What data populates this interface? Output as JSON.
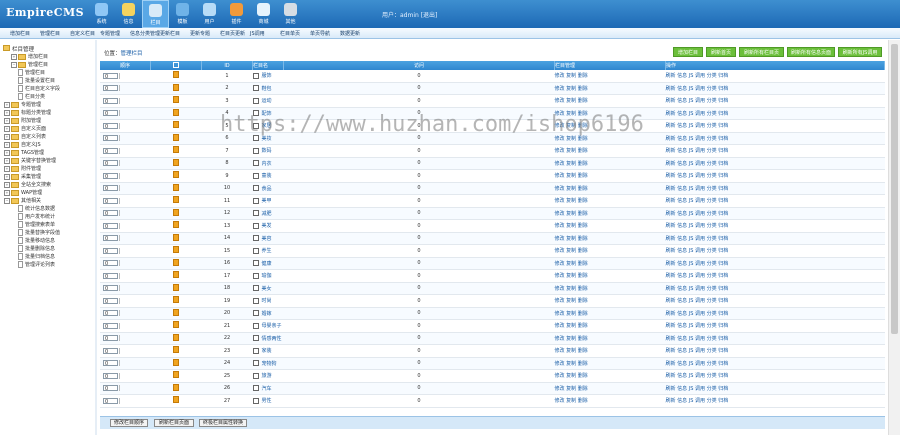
{
  "app": {
    "logo": "EmpireCMS",
    "user_info": "用户：admin  [退出]"
  },
  "topnav": [
    {
      "label": "系统",
      "icon": "system-icon",
      "color": "#8fc7f5"
    },
    {
      "label": "信息",
      "icon": "edit-icon",
      "color": "#f4d35e"
    },
    {
      "label": "栏目",
      "icon": "folder-icon",
      "color": "#d8eaf8"
    },
    {
      "label": "模板",
      "icon": "template-icon",
      "color": "#6fb3e8"
    },
    {
      "label": "用户",
      "icon": "user-icon",
      "color": "#b8dcf7"
    },
    {
      "label": "插件",
      "icon": "plugin-icon",
      "color": "#f29a3a"
    },
    {
      "label": "商城",
      "icon": "shop-icon",
      "color": "#e6f3fc"
    },
    {
      "label": "其他",
      "icon": "gear-icon",
      "color": "#d6dde4"
    }
  ],
  "subnav": [
    "增加栏目",
    "管理栏目",
    "自定义栏目",
    "专题管理",
    "信息分类管理",
    "更新栏目",
    "更新专题",
    "栏目页更新",
    "JS调用",
    "栏目单页",
    "单页导航",
    "数据更新"
  ],
  "sidebar": {
    "title": "栏目管理",
    "items": [
      {
        "label": "增加栏目",
        "indent": 1,
        "kind": "folder"
      },
      {
        "label": "管理栏目",
        "indent": 1,
        "kind": "folder",
        "open": true
      },
      {
        "label": "管理栏目",
        "indent": 2,
        "kind": "doc"
      },
      {
        "label": "批量设置栏目",
        "indent": 2,
        "kind": "doc"
      },
      {
        "label": "栏目自定义字段",
        "indent": 2,
        "kind": "doc"
      },
      {
        "label": "栏目分类",
        "indent": 2,
        "kind": "doc"
      },
      {
        "label": "专题管理",
        "indent": 0,
        "kind": "folder"
      },
      {
        "label": "标题分类管理",
        "indent": 0,
        "kind": "folder"
      },
      {
        "label": "附加管理",
        "indent": 0,
        "kind": "folder"
      },
      {
        "label": "自定义页面",
        "indent": 0,
        "kind": "folder"
      },
      {
        "label": "自定义列表",
        "indent": 0,
        "kind": "folder"
      },
      {
        "label": "自定义JS",
        "indent": 0,
        "kind": "folder"
      },
      {
        "label": "TAGS管理",
        "indent": 0,
        "kind": "folder"
      },
      {
        "label": "关键字替换管理",
        "indent": 0,
        "kind": "folder"
      },
      {
        "label": "附件管理",
        "indent": 0,
        "kind": "folder"
      },
      {
        "label": "采集管理",
        "indent": 0,
        "kind": "folder"
      },
      {
        "label": "全站全文搜索",
        "indent": 0,
        "kind": "folder"
      },
      {
        "label": "WAP管理",
        "indent": 0,
        "kind": "folder"
      },
      {
        "label": "其他相关",
        "indent": 0,
        "kind": "folder",
        "open": true
      },
      {
        "label": "统计信息数据",
        "indent": 2,
        "kind": "doc"
      },
      {
        "label": "用户发布统计",
        "indent": 2,
        "kind": "doc"
      },
      {
        "label": "管理搜索表单",
        "indent": 2,
        "kind": "doc"
      },
      {
        "label": "批量替换字段值",
        "indent": 2,
        "kind": "doc"
      },
      {
        "label": "批量移动信息",
        "indent": 2,
        "kind": "doc"
      },
      {
        "label": "批量删除信息",
        "indent": 2,
        "kind": "doc"
      },
      {
        "label": "批量归档信息",
        "indent": 2,
        "kind": "doc"
      },
      {
        "label": "管理评论列表",
        "indent": 2,
        "kind": "doc"
      }
    ]
  },
  "breadcrumb": {
    "prefix": "位置：",
    "link": "管理栏目"
  },
  "actions": [
    "增加栏目",
    "刷新首页",
    "刷新所有栏目页",
    "刷新所有信息页面",
    "刷新所有JS调用"
  ],
  "table": {
    "headers": [
      "顺序",
      "",
      "ID",
      "栏目名",
      "访问",
      "栏目管理",
      "操作"
    ],
    "rows": [
      {
        "sort": "0",
        "id": "1",
        "name": "服饰",
        "visits": "0"
      },
      {
        "sort": "0",
        "id": "2",
        "name": "鞋包",
        "visits": "0"
      },
      {
        "sort": "0",
        "id": "3",
        "name": "运动",
        "visits": "0"
      },
      {
        "sort": "0",
        "id": "4",
        "name": "配饰",
        "visits": "0"
      },
      {
        "sort": "0",
        "id": "5",
        "name": "家居",
        "visits": "0"
      },
      {
        "sort": "0",
        "id": "6",
        "name": "美妆",
        "visits": "0"
      },
      {
        "sort": "0",
        "id": "7",
        "name": "数码",
        "visits": "0"
      },
      {
        "sort": "0",
        "id": "8",
        "name": "内衣",
        "visits": "0"
      },
      {
        "sort": "0",
        "id": "9",
        "name": "童装",
        "visits": "0"
      },
      {
        "sort": "0",
        "id": "10",
        "name": "食品",
        "visits": "0"
      },
      {
        "sort": "0",
        "id": "11",
        "name": "美甲",
        "visits": "0"
      },
      {
        "sort": "0",
        "id": "12",
        "name": "减肥",
        "visits": "0"
      },
      {
        "sort": "0",
        "id": "13",
        "name": "美发",
        "visits": "0"
      },
      {
        "sort": "0",
        "id": "14",
        "name": "美容",
        "visits": "0"
      },
      {
        "sort": "0",
        "id": "15",
        "name": "养生",
        "visits": "0"
      },
      {
        "sort": "0",
        "id": "16",
        "name": "健康",
        "visits": "0"
      },
      {
        "sort": "0",
        "id": "17",
        "name": "瑜伽",
        "visits": "0"
      },
      {
        "sort": "0",
        "id": "18",
        "name": "美女",
        "visits": "0"
      },
      {
        "sort": "0",
        "id": "19",
        "name": "时尚",
        "visits": "0"
      },
      {
        "sort": "0",
        "id": "20",
        "name": "婚嫁",
        "visits": "0"
      },
      {
        "sort": "0",
        "id": "21",
        "name": "母婴亲子",
        "visits": "0"
      },
      {
        "sort": "0",
        "id": "22",
        "name": "情感两性",
        "visits": "0"
      },
      {
        "sort": "0",
        "id": "23",
        "name": "家装",
        "visits": "0"
      },
      {
        "sort": "0",
        "id": "24",
        "name": "宠物狗",
        "visits": "0"
      },
      {
        "sort": "0",
        "id": "25",
        "name": "旅游",
        "visits": "0"
      },
      {
        "sort": "0",
        "id": "26",
        "name": "汽车",
        "visits": "0"
      },
      {
        "sort": "0",
        "id": "27",
        "name": "男性",
        "visits": "0"
      }
    ],
    "manage_links": [
      "修改",
      "复制",
      "删除"
    ],
    "op_links": [
      "刷新",
      "信息",
      "JS",
      "调用",
      "分类",
      "归档"
    ]
  },
  "footer": [
    "修改栏目顺序",
    "刷新栏目页面",
    "终极栏目属性转换"
  ],
  "watermark": "https://www.huzhan.com/ishop6196"
}
